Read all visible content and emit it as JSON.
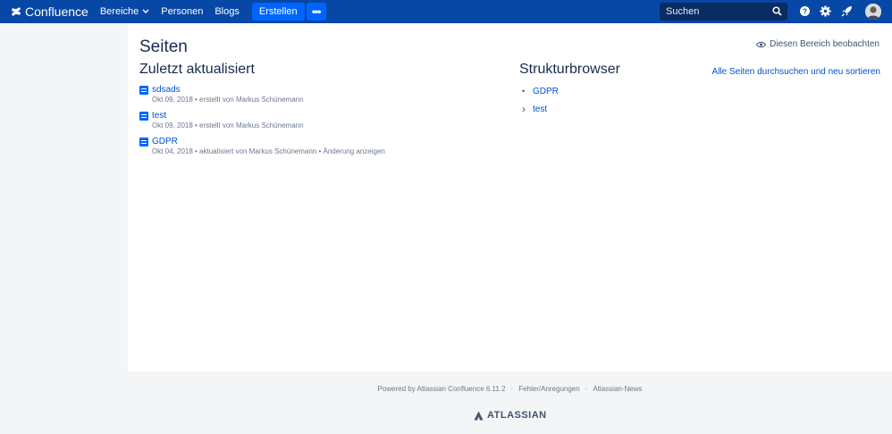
{
  "header": {
    "logo_text": "Confluence",
    "nav": [
      {
        "label": "Bereiche"
      },
      {
        "label": "Personen"
      },
      {
        "label": "Blogs"
      }
    ],
    "create_label": "Erstellen",
    "more_label": "•••",
    "search_placeholder": "Suchen"
  },
  "main": {
    "title": "Seiten",
    "watch_label": "Diesen Bereich beobachten",
    "recent": {
      "heading": "Zuletzt aktualisiert",
      "items": [
        {
          "title": "sdsads",
          "meta": "Okt 09, 2018 • erstellt von Markus Schünemann"
        },
        {
          "title": "test",
          "meta": "Okt 09, 2018 • erstellt von Markus Schünemann"
        },
        {
          "title": "GDPR",
          "meta": "Okt 04, 2018 • aktualisiert von Markus Schünemann • Änderung anzeigen"
        }
      ]
    },
    "tree": {
      "heading": "Strukturbrowser",
      "browse_all": "Alle Seiten durchsuchen und neu sortieren",
      "items": [
        {
          "label": "GDPR",
          "marker": "•"
        },
        {
          "label": "test",
          "marker": "›"
        }
      ]
    }
  },
  "footer": {
    "powered": "Powered by Atlassian Confluence 6.11.2",
    "sep": "·",
    "feedback": "Fehler/Anregungen",
    "news": "Atlassian-News",
    "brand": "ATLASSIAN"
  },
  "colors": {
    "header_bg": "#0747a6",
    "accent": "#0065ff",
    "link": "#0052cc"
  }
}
